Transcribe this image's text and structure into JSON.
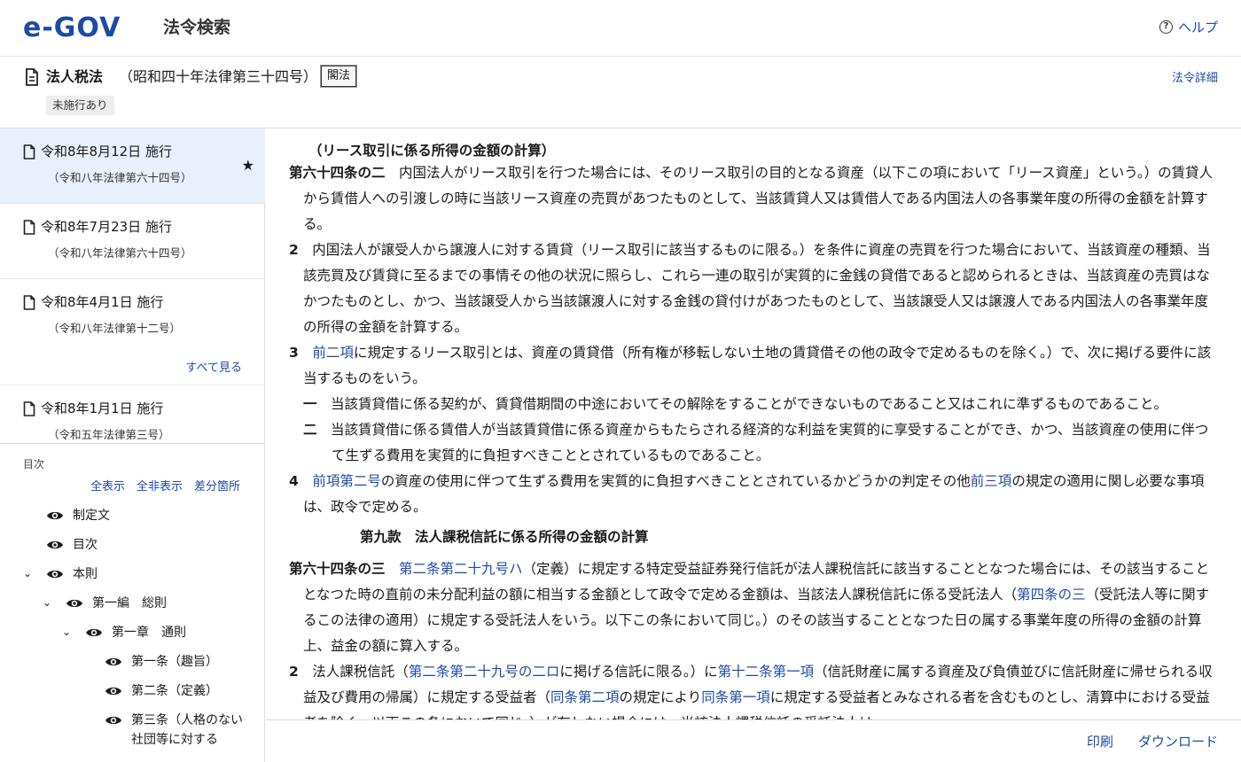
{
  "header": {
    "logo_text": "e-GOV",
    "app_title": "法令検索",
    "help_label": "ヘルプ"
  },
  "law": {
    "name": "法人税法",
    "number": "（昭和四十年法律第三十四号）",
    "abbr_button": "閣法",
    "status_badge": "未施行あり",
    "detail_link": "法令詳細"
  },
  "versions": {
    "items": [
      {
        "title": "令和8年8月12日 施行",
        "law": "（令和八年法律第六十四号）",
        "starred": true
      },
      {
        "title": "令和8年7月23日 施行",
        "law": "（令和八年法律第六十四号）",
        "starred": false
      },
      {
        "title": "令和8年4月1日 施行",
        "law": "（令和八年法律第十二号）",
        "starred": false
      },
      {
        "title": "令和8年1月1日 施行",
        "law": "（令和五年法律第三号）",
        "starred": false
      }
    ],
    "see_all": "すべて見る"
  },
  "toc": {
    "label": "目次",
    "actions": [
      "全表示",
      "全非表示",
      "差分箇所"
    ],
    "items": [
      {
        "label": "制定文"
      },
      {
        "label": "目次"
      },
      {
        "label": "本則"
      },
      {
        "label": "第一編　総則"
      },
      {
        "label": "第一章　通則"
      },
      {
        "label": "第一条（趣旨）"
      },
      {
        "label": "第二条（定義）"
      },
      {
        "label": "第三条（人格のない社団等に対する"
      }
    ],
    "item8_line2": "い社団等に対する"
  },
  "content": {
    "caption": "（リース取引に係る所得の金額の計算）",
    "art64_2": {
      "title": "第六十四条の二",
      "p1": "　内国法人がリース取引を行つた場合には、そのリース取引の目的となる資産（以下この項において「リース資産」という。）の賃貸人から賃借人への引渡しの時に当該リース資産の売買があつたものとして、当該賃貸人又は賃借人である内国法人の各事業年度の所得の金額を計算する。",
      "p2_num": "2",
      "p2": "　内国法人が譲受人から譲渡人に対する賃貸（リース取引に該当するものに限る。）を条件に資産の売買を行つた場合において、当該資産の種類、当該売買及び賃貸に至るまでの事情その他の状況に照らし、これら一連の取引が実質的に金銭の貸借であると認められるときは、当該資産の売買はなかつたものとし、かつ、当該譲受人から当該譲渡人に対する金銭の貸付けがあつたものとして、当該譲受人又は譲渡人である内国法人の各事業年度の所得の金額を計算する。",
      "p3_num": "3",
      "p3_link": "前二項",
      "p3": "に規定するリース取引とは、資産の賃貸借（所有権が移転しない土地の賃貸借その他の政令で定めるものを除く。）で、次に掲げる要件に該当するものをいう。",
      "i1_num": "一",
      "i1": "　当該賃貸借に係る契約が、賃貸借期間の中途においてその解除をすることができないものであること又はこれに準ずるものであること。",
      "i2_num": "二",
      "i2": "　当該賃貸借に係る賃借人が当該賃貸借に係る資産からもたらされる経済的な利益を実質的に享受することができ、かつ、当該資産の使用に伴つて生ずる費用を実質的に負担すべきこととされているものであること。",
      "p4_num": "4",
      "p4_link1": "前項第二号",
      "p4_a": "の資産の使用に伴つて生ずる費用を実質的に負担すべきこととされているかどうかの判定その他",
      "p4_link2": "前三項",
      "p4_b": "の規定の適用に関し必要な事項は、政令で定める。"
    },
    "section_head": "第九款　法人課税信託に係る所得の金額の計算",
    "art64_3": {
      "title": "第六十四条の三",
      "p1_link1": "第二条第二十九号ハ",
      "p1_a": "（定義）に規定する特定受益証券発行信託が法人課税信託に該当することとなつた場合には、その該当することとなつた時の直前の未分配利益の額に相当する金額として政令で定める金額は、当該法人課税信託に係る受託法人（",
      "p1_link2": "第四条の三",
      "p1_b": "（受託法人等に関するこの法律の適用）に規定する受託法人をいう。以下この条において同じ。）のその該当することとなつた日の属する事業年度の所得の金額の計算上、益金の額に算入する。",
      "p2_num": "2",
      "p2_a": "　法人課税信託（",
      "p2_link1": "第二条第二十九号の二ロ",
      "p2_b": "に掲げる信託に限る。）に",
      "p2_link2": "第十二条第一項",
      "p2_c": "（信託財産に属する資産及び負債並びに信託財産に帰せられる収益及び費用の帰属）に規定する受益者（",
      "p2_link3": "同条第二項",
      "p2_d": "の規定により",
      "p2_link4": "同条第一項",
      "p2_e": "に規定する受益者とみなされる者を含むものとし、清算中における受益者を除く。以下この条において同じ。）が存しない場合には、当該法人課税信託の受託法人は、"
    }
  },
  "footer": {
    "print_label": "印刷",
    "download_label": "ダウンロード"
  },
  "colors": {
    "brand": "#1d4aa8",
    "link": "#1d4aa8",
    "active_bg": "#e8f1fb"
  }
}
